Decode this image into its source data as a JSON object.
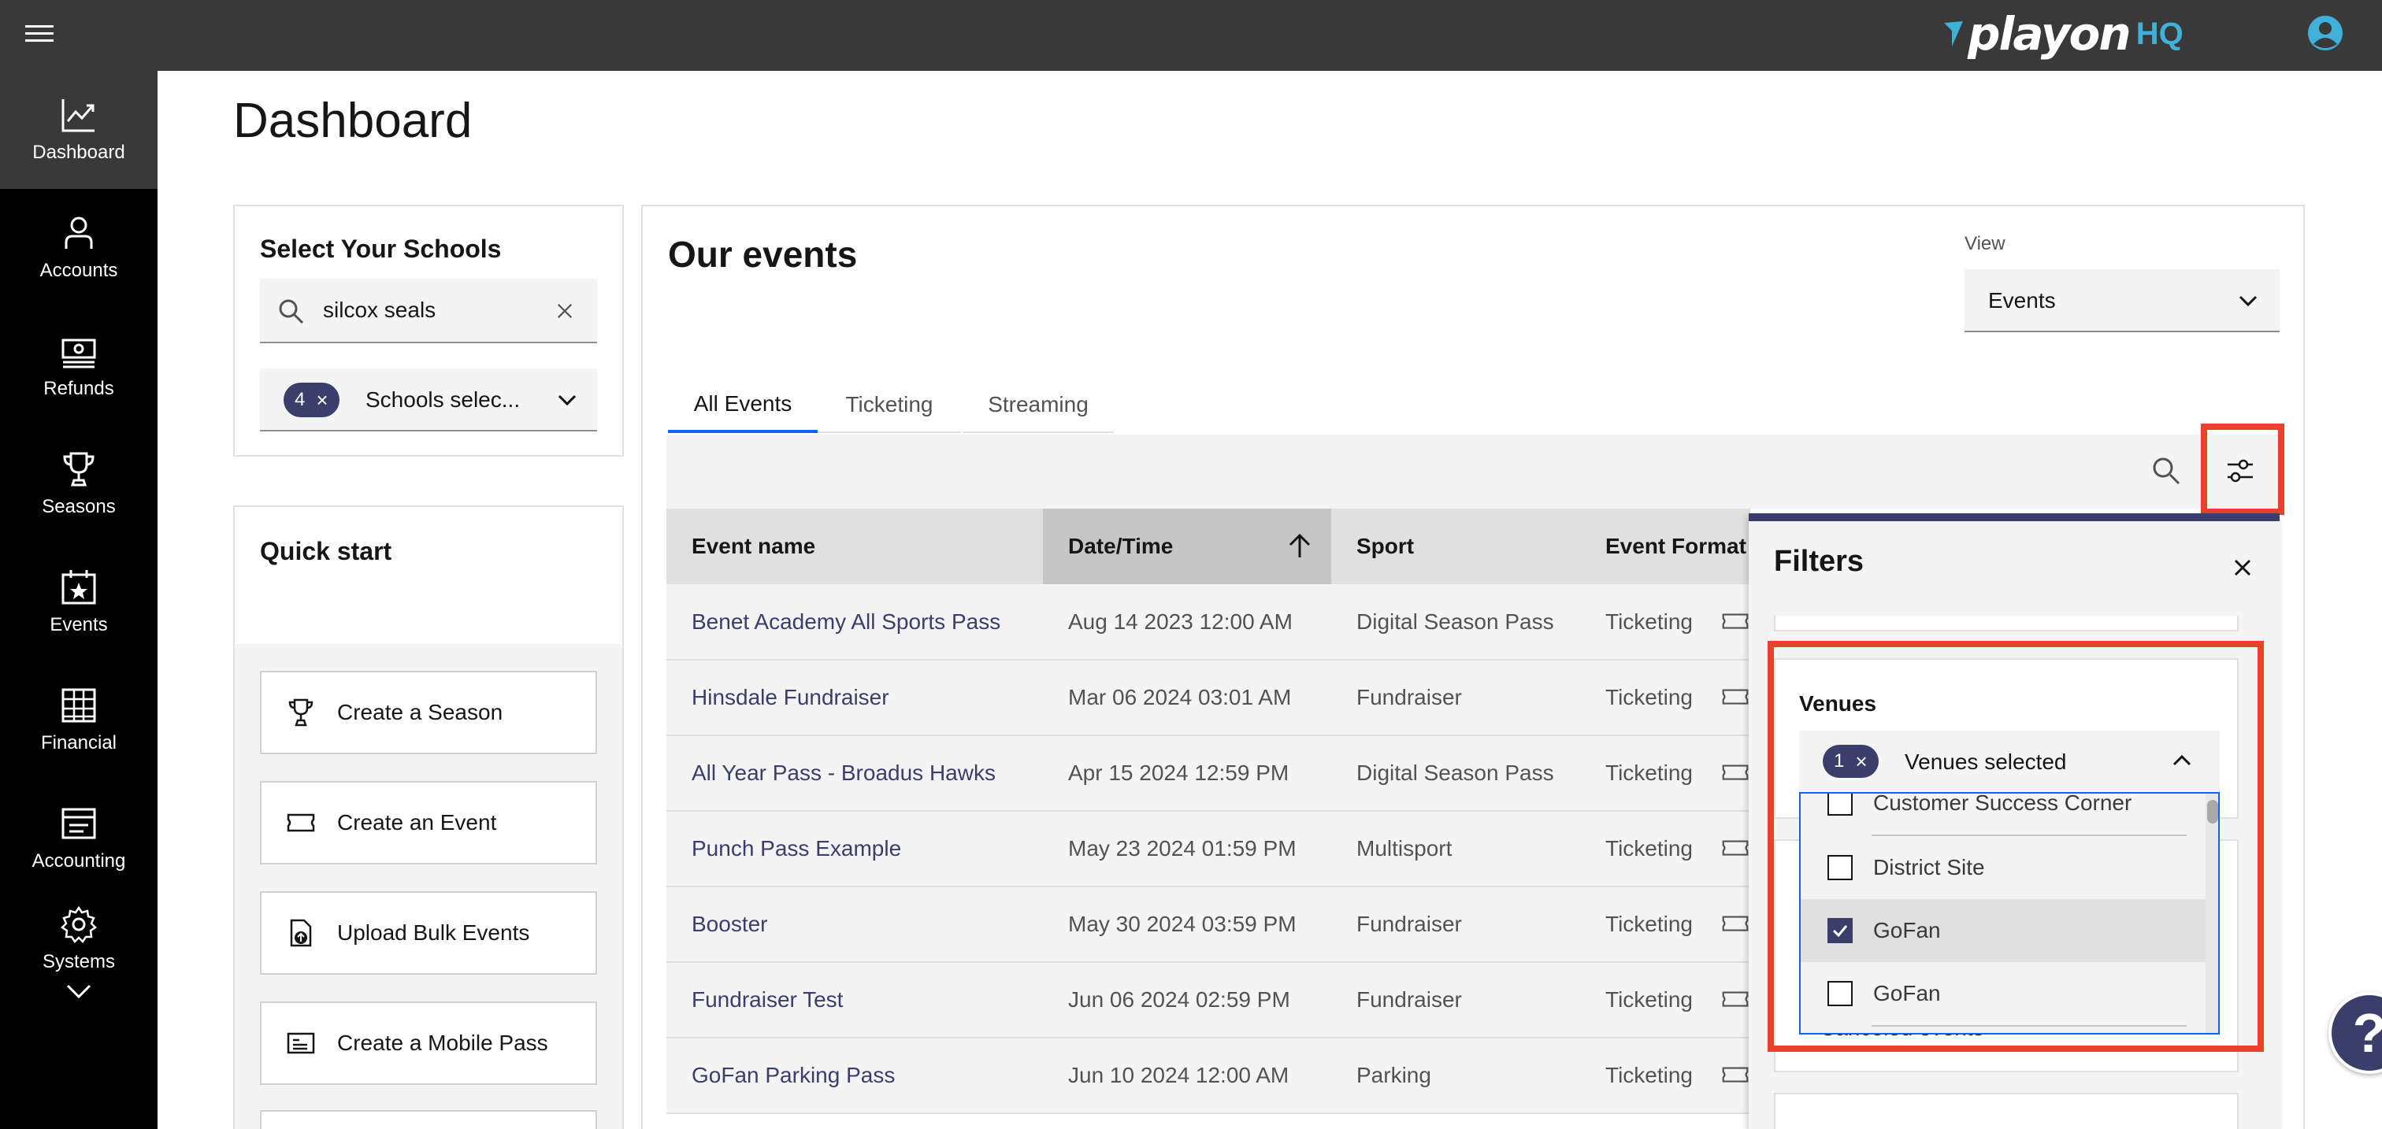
{
  "app": {
    "brand": "playon",
    "brand_suffix": "HQ"
  },
  "sidenav": {
    "items": [
      {
        "label": "Dashboard",
        "icon": "chart-icon",
        "active": true
      },
      {
        "label": "Accounts",
        "icon": "user-icon"
      },
      {
        "label": "Refunds",
        "icon": "money-icon"
      },
      {
        "label": "Seasons",
        "icon": "trophy-icon"
      },
      {
        "label": "Events",
        "icon": "calendar-star-icon"
      },
      {
        "label": "Financial",
        "icon": "grid-icon"
      },
      {
        "label": "Accounting",
        "icon": "ledger-icon"
      },
      {
        "label": "Systems",
        "icon": "gear-icon"
      }
    ]
  },
  "page": {
    "title": "Dashboard"
  },
  "schools": {
    "title": "Select Your Schools",
    "search_value": "silcox seals",
    "selected_count": "4",
    "selected_label": "Schools selec..."
  },
  "quickstart": {
    "title": "Quick start",
    "buttons": [
      {
        "label": "Create a Season",
        "icon": "trophy-icon"
      },
      {
        "label": "Create an Event",
        "icon": "ticket-icon"
      },
      {
        "label": "Upload Bulk Events",
        "icon": "upload-icon"
      },
      {
        "label": "Create a Mobile Pass",
        "icon": "card-icon"
      }
    ]
  },
  "events": {
    "title": "Our events",
    "view_label": "View",
    "view_value": "Events",
    "tabs": [
      "All Events",
      "Ticketing",
      "Streaming"
    ],
    "columns": [
      "Event name",
      "Date/Time",
      "Sport",
      "Event Format"
    ],
    "rows": [
      {
        "name": "Benet Academy All Sports Pass",
        "date": "Aug 14 2023 12:00 AM",
        "sport": "Digital Season Pass",
        "format": "Ticketing"
      },
      {
        "name": "Hinsdale Fundraiser",
        "date": "Mar 06 2024 03:01 AM",
        "sport": "Fundraiser",
        "format": "Ticketing"
      },
      {
        "name": "All Year Pass - Broadus Hawks",
        "date": "Apr 15 2024 12:59 PM",
        "sport": "Digital Season Pass",
        "format": "Ticketing"
      },
      {
        "name": "Punch Pass Example",
        "date": "May 23 2024 01:59 PM",
        "sport": "Multisport",
        "format": "Ticketing"
      },
      {
        "name": "Booster",
        "date": "May 30 2024 03:59 PM",
        "sport": "Fundraiser",
        "format": "Ticketing"
      },
      {
        "name": "Fundraiser Test",
        "date": "Jun 06 2024 02:59 PM",
        "sport": "Fundraiser",
        "format": "Ticketing"
      },
      {
        "name": "GoFan Parking Pass",
        "date": "Jun 10 2024 12:00 AM",
        "sport": "Parking",
        "format": "Ticketing"
      }
    ]
  },
  "filters": {
    "title": "Filters",
    "venues_label": "Venues",
    "venues_count": "1",
    "venues_selected_label": "Venues selected",
    "options": [
      {
        "label": "Customer Success Corner",
        "checked": false
      },
      {
        "label": "District Site",
        "checked": false
      },
      {
        "label": "GoFan",
        "checked": true
      },
      {
        "label": "GoFan",
        "checked": false
      }
    ],
    "hidden_behind": "Canceled events"
  },
  "colors": {
    "accent": "#393e6b",
    "highlight": "#e8412c",
    "tab_active": "#0f62fe"
  }
}
